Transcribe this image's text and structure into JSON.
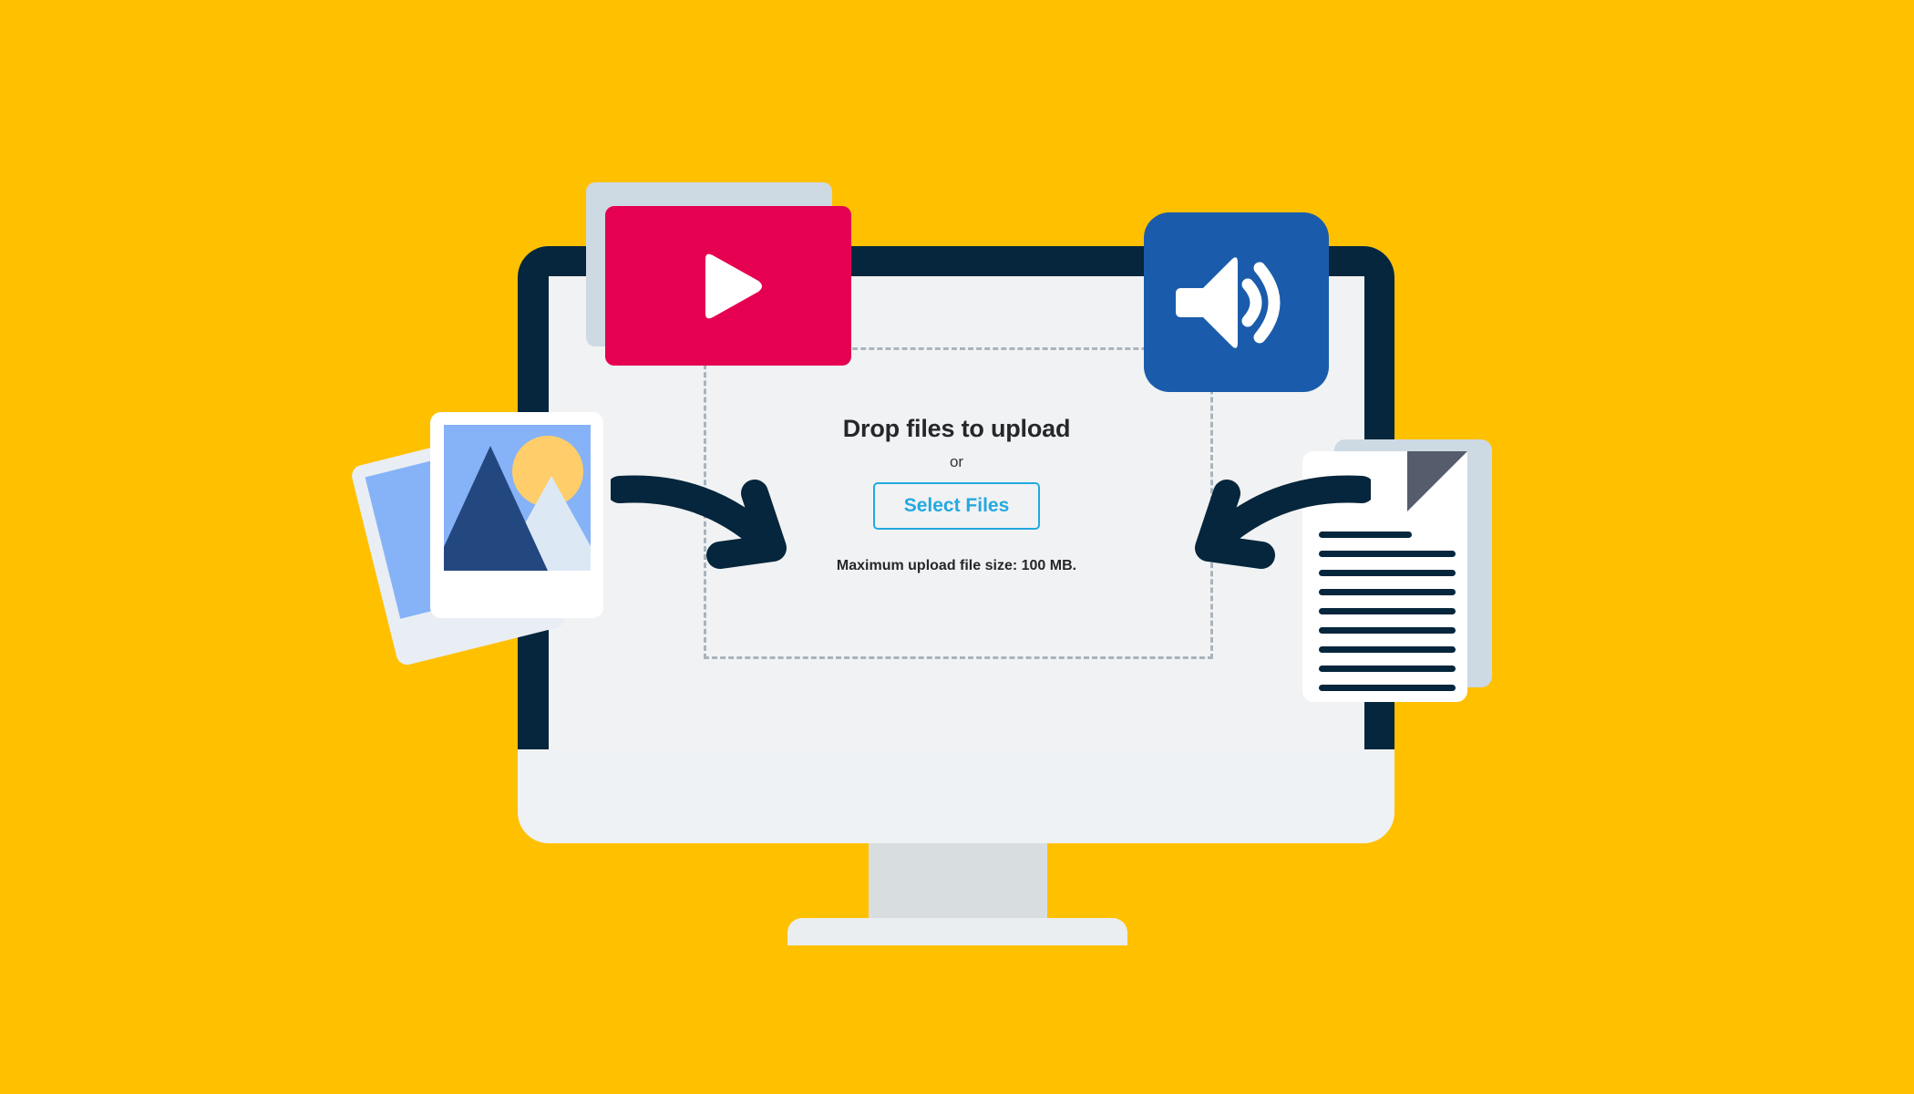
{
  "page": {
    "background_color": "#FFC000",
    "title": "File upload illustration"
  },
  "monitor": {
    "frame_color": "#05263C",
    "screen_color": "#F1F2F3",
    "body_color": "#EFF2F4",
    "stand_color": "#D8DDE0",
    "base_color": "#EAEEF0"
  },
  "upload": {
    "drop_title": "Drop files to upload",
    "or_label": "or",
    "select_files_label": "Select Files",
    "max_size_note": "Maximum upload file size: 100 MB.",
    "accent_color": "#22A9E0",
    "dropzone_border_color": "#A9B4BC",
    "text_color": "#25282B"
  },
  "media_cards": {
    "video": {
      "icon": "play-icon",
      "color": "#E50051",
      "shadow_color": "#CDD9E3"
    },
    "audio": {
      "icon": "speaker-icon",
      "color": "#1A5CAB"
    },
    "photos": {
      "icon": "image-icon",
      "frame_color": "#FFFFFF",
      "sky_color": "#86B2F7",
      "mountain_color": "#23487F",
      "sun_color": "#FFCE6A",
      "peak_color": "#DCE9F5"
    },
    "document": {
      "icon": "document-icon",
      "page_color": "#FFFFFF",
      "fold_color": "#555C6B",
      "back_page_color": "#CDD9E3",
      "line_color": "#05263C",
      "line_count": 9
    }
  },
  "arrows": {
    "color": "#05263C",
    "left": "arrow-curve-right-icon",
    "right": "arrow-curve-left-icon"
  }
}
